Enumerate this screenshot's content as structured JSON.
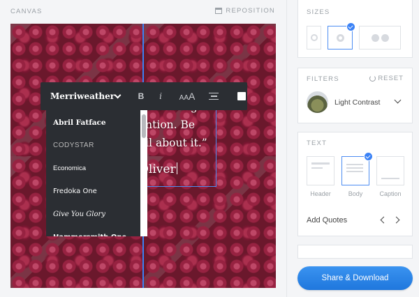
{
  "canvas": {
    "label": "CANVAS",
    "reposition_label": "REPOSITION",
    "quote": {
      "lines": [
        "s for living a",
        "ention. Be",
        "ell about it.”"
      ],
      "author": "Oliver"
    }
  },
  "toolbar": {
    "font_selected": "Merriweather",
    "bold_label": "B",
    "italic_label": "i",
    "size_label_small": "A",
    "size_label_large": "A",
    "color": "#ffffff"
  },
  "font_menu": {
    "items": [
      "Abril Fatface",
      "CODYSTAR",
      "Economica",
      "Fredoka One",
      "Give You Glory",
      "Hammersmith One"
    ]
  },
  "sizes": {
    "title": "SIZES",
    "selected_index": 1,
    "accent": "#3b82f6"
  },
  "filters": {
    "title": "FILTERS",
    "reset_label": "RESET",
    "selected": "Light Contrast"
  },
  "text_panel": {
    "title": "TEXT",
    "layouts": [
      "Header",
      "Body",
      "Caption"
    ],
    "selected_index": 1,
    "add_quotes_label": "Add Quotes"
  },
  "actions": {
    "share_label": "Share & Download"
  }
}
